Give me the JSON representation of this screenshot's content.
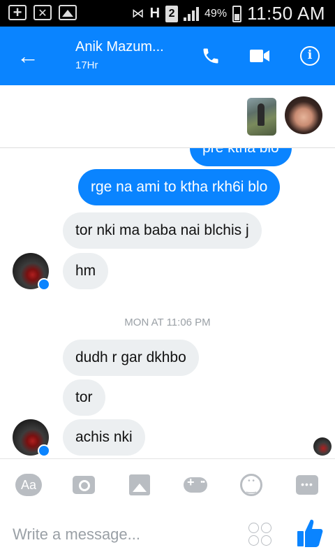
{
  "status_bar": {
    "battery": "49%",
    "network_h": "H",
    "sim": "2",
    "time": "11:50 AM"
  },
  "header": {
    "contact_name": "Anik Mazum...",
    "status": "17Hr",
    "icons": [
      "back-arrow-icon",
      "phone-icon",
      "video-camera-icon",
      "info-icon"
    ],
    "accent_color": "#0a84ff"
  },
  "conversation": {
    "partial_top_message": "pre ktha blo",
    "messages_1": [
      {
        "from": "me",
        "text": "rge na ami to ktha rkh6i blo"
      },
      {
        "from": "them",
        "text": "tor nki ma baba nai blchis j"
      },
      {
        "from": "them",
        "text": "hm"
      }
    ],
    "timestamp": "MON AT 11:06 PM",
    "messages_2": [
      {
        "from": "them",
        "text": "dudh r gar dkhbo"
      },
      {
        "from": "them",
        "text": "tor"
      },
      {
        "from": "them",
        "text": "achis nki"
      }
    ],
    "bubble_colors": {
      "outgoing": "#0a84ff",
      "incoming": "#eceff1"
    }
  },
  "composer": {
    "aa_label": "Aa",
    "placeholder": "Write a message...",
    "toolbar_icons": [
      "text-style-icon",
      "camera-icon",
      "gallery-icon",
      "gamepad-icon",
      "emoji-icon",
      "more-icon"
    ]
  }
}
